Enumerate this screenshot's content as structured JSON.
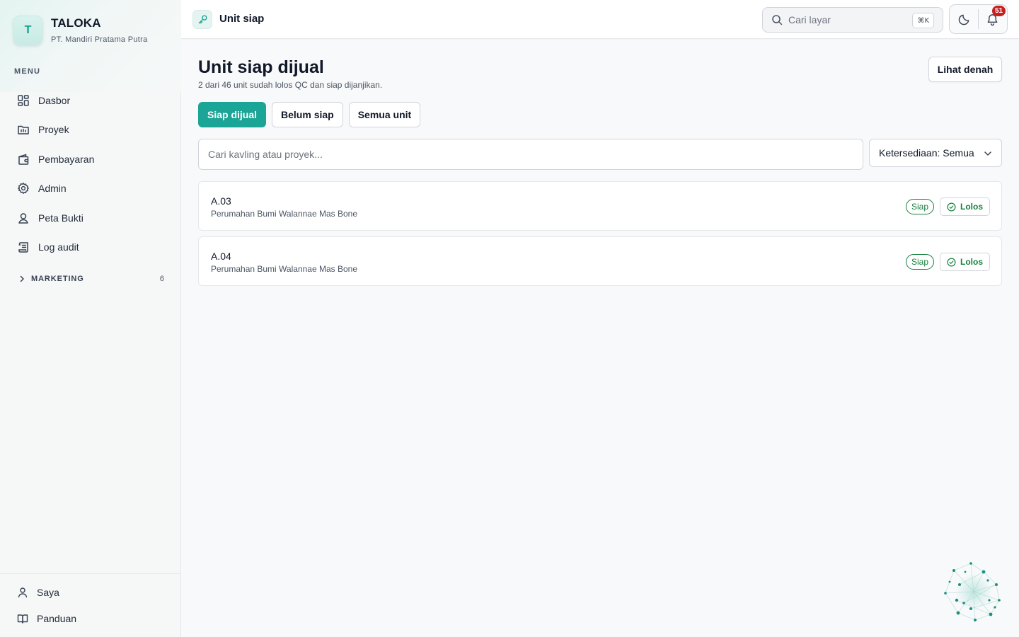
{
  "sidebar": {
    "brand_initial": "T",
    "brand_name": "TALOKA",
    "company": "PT. Mandiri Pratama Putra",
    "menu_heading": "MENU",
    "items": [
      {
        "label": "Dasbor",
        "icon": "dashboard-icon"
      },
      {
        "label": "Proyek",
        "icon": "folder-icon"
      },
      {
        "label": "Pembayaran",
        "icon": "wallet-icon"
      },
      {
        "label": "Admin",
        "icon": "gear-icon"
      },
      {
        "label": "Peta Bukti",
        "icon": "map-pin-icon"
      },
      {
        "label": "Log audit",
        "icon": "scroll-icon"
      }
    ],
    "section": {
      "label": "MARKETING",
      "count": "6",
      "icon": "chevron-right-icon"
    },
    "bottom_items": [
      {
        "label": "Saya",
        "icon": "user-icon"
      },
      {
        "label": "Panduan",
        "icon": "book-icon"
      }
    ]
  },
  "topbar": {
    "page_icon": "key-icon",
    "title": "Unit siap",
    "search_placeholder": "Cari layar",
    "search_shortcut": "⌘K",
    "theme_icon": "moon-icon",
    "notification_icon": "bell-icon",
    "notification_count": "51"
  },
  "main": {
    "title": "Unit siap dijual",
    "subtitle": "2 dari 46 unit sudah lolos QC dan siap dijanjikan.",
    "map_button": "Lihat denah",
    "tabs": [
      {
        "label": "Siap dijual",
        "active": true
      },
      {
        "label": "Belum siap",
        "active": false
      },
      {
        "label": "Semua unit",
        "active": false
      }
    ],
    "filter_placeholder": "Cari kavling atau proyek...",
    "filter_value": "",
    "availability": "Ketersediaan: Semua",
    "units": [
      {
        "code": "A.03",
        "project": "Perumahan Bumi Walannae Mas Bone",
        "status": "Siap",
        "qc": "Lolos"
      },
      {
        "code": "A.04",
        "project": "Perumahan Bumi Walannae Mas Bone",
        "status": "Siap",
        "qc": "Lolos"
      }
    ]
  },
  "colors": {
    "accent": "#1aa597",
    "success": "#15803d",
    "badge_red": "#c81e1e"
  }
}
